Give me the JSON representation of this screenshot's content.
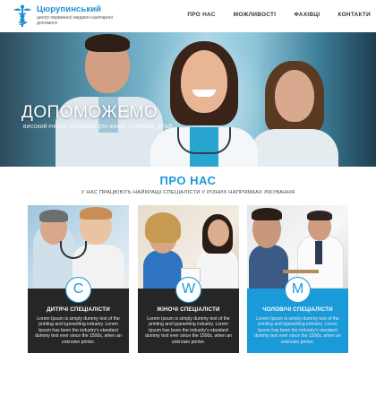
{
  "header": {
    "brand_title": "Цюрупинський",
    "brand_subtitle": "центр первинної медико-санітарної допомоги",
    "logo_icon": "caduceus-icon",
    "nav": [
      "ПРО НАС",
      "МОЖЛИВОСТІ",
      "ФАХІВЦІ",
      "КОНТАКТИ"
    ]
  },
  "hero": {
    "title": "ДОПОМОЖЕМО",
    "subtitle": "ВИСОКИЙ РІВЕНЬ ЛІКУВАННЯ ДЛЯ ЖІНОК, ЧОЛОВІКІВ, ДІТЕЙ"
  },
  "about": {
    "title": "ПРО НАС",
    "subtitle": "У НАС ПРАЦЮЮТЬ НАЙКРАЩІ СПЕЦІАЛІСТИ У РІЗНИХ НАПРЯМКАХ ЛІКУВАННЯ"
  },
  "cards": [
    {
      "letter": "C",
      "title": "ДИТЯЧІ СПЕЦІАЛІСТИ",
      "text": "Lorem Ipsum is simply dummy text of the printing and typesetting industry. Lorem Ipsum has been the industry's standard dummy text ever since the 1500s, when an unknown printer."
    },
    {
      "letter": "W",
      "title": "ЖІНОЧІ СПЕЦІАЛІСТИ",
      "text": "Lorem Ipsum is simply dummy text of the printing and typesetting industry. Lorem Ipsum has been the industry's standard dummy text ever since the 1500s, when an unknown printer."
    },
    {
      "letter": "M",
      "title": "ЧОЛОВІЧІ СПЕЦІАЛІСТИ",
      "text": "Lorem Ipsum is simply dummy text of the printing and typesetting industry. Lorem Ipsum has been the industry's standard dummy text ever since the 1500s, when an unknown printer."
    }
  ],
  "colors": {
    "accent": "#1a9ad9",
    "card_dark": "#262626",
    "text_dark": "#333333"
  }
}
